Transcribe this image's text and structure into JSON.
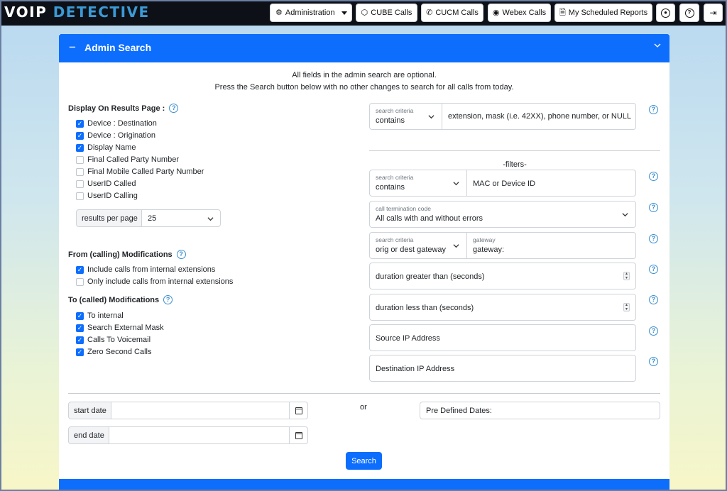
{
  "logo": {
    "part1": "VOIP",
    "part2": "DETECTIVE"
  },
  "nav": {
    "administration": "Administration",
    "cube_calls": "CUBE Calls",
    "cucm_calls": "CUCM Calls",
    "webex_calls": "Webex Calls",
    "scheduled_reports": "My Scheduled Reports"
  },
  "panel": {
    "title": "Admin Search",
    "intro_line1": "All fields in the admin search are optional.",
    "intro_line2": "Press the Search button below with no other changes to search for all calls from today."
  },
  "display": {
    "title": "Display On Results Page :",
    "items": [
      {
        "label": "Device : Destination",
        "checked": true
      },
      {
        "label": "Device : Origination",
        "checked": true
      },
      {
        "label": "Display Name",
        "checked": true
      },
      {
        "label": "Final Called Party Number",
        "checked": false
      },
      {
        "label": "Final Mobile Called Party Number",
        "checked": false
      },
      {
        "label": "UserID Called",
        "checked": false
      },
      {
        "label": "UserID Calling",
        "checked": false
      }
    ],
    "results_per_page_label": "results per page",
    "results_per_page_value": "25"
  },
  "from_mod": {
    "title": "From (calling) Modifications",
    "items": [
      {
        "label": "Include calls from internal extensions",
        "checked": true
      },
      {
        "label": "Only include calls from internal extensions",
        "checked": false
      }
    ]
  },
  "to_mod": {
    "title": "To (called) Modifications",
    "items": [
      {
        "label": "To internal",
        "checked": true
      },
      {
        "label": "Search External Mask",
        "checked": true
      },
      {
        "label": "Calls To Voicemail",
        "checked": true
      },
      {
        "label": "Zero Second Calls",
        "checked": true
      }
    ]
  },
  "criteria1": {
    "label": "search criteria",
    "value": "contains",
    "placeholder": "extension, mask (i.e. 42XX), phone number, or NULL"
  },
  "filters_label": "-filters-",
  "criteria2": {
    "label": "search criteria",
    "value": "contains",
    "placeholder": "MAC or Device ID"
  },
  "termination": {
    "label": "call termination code",
    "value": "All calls with and without errors"
  },
  "criteria3": {
    "label": "search criteria",
    "value": "orig or dest gateway",
    "gateway_label": "gateway",
    "gateway_value": "gateway:"
  },
  "duration_gt": "duration greater than (seconds)",
  "duration_lt": "duration less than (seconds)",
  "source_ip": "Source IP Address",
  "dest_ip": "Destination IP Address",
  "dates": {
    "start_label": "start date",
    "end_label": "end date",
    "or": "or",
    "predefined": "Pre Defined Dates:"
  },
  "search_button": "Search",
  "colors": {
    "primary": "#0d6efd",
    "topbar": "#0d1117",
    "logo_accent": "#3b9ad6",
    "help": "#3b8ed0"
  }
}
